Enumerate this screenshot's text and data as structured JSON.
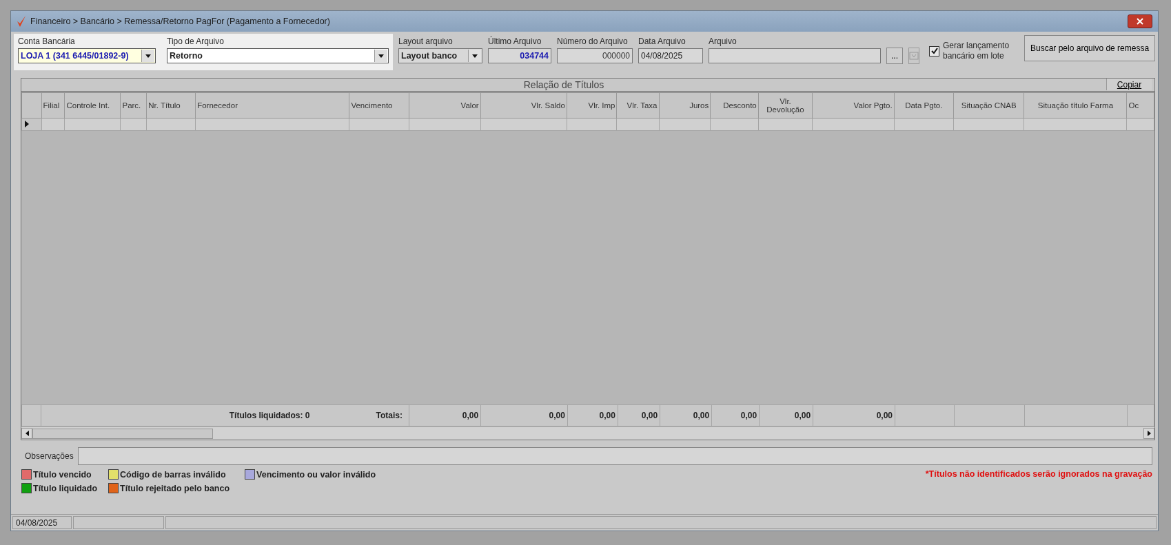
{
  "window": {
    "title": "Financeiro > Bancário > Remessa/Retorno PagFor (Pagamento  a Fornecedor)"
  },
  "filters": [
    {
      "kind": "combo",
      "label": "Conta Bancária",
      "value": "LOJA 1 (341 6445/01892-9)",
      "highlighted": true
    },
    {
      "kind": "combo",
      "label": "Tipo de Arquivo",
      "value": "Retorno",
      "highlighted": true
    },
    {
      "kind": "combo",
      "label": "Layout arquivo",
      "value": "Layout banco",
      "highlighted": false
    },
    {
      "kind": "number",
      "label": "Último Arquivo",
      "value": "034744",
      "highlighted": false
    },
    {
      "kind": "number",
      "label": "Número do Arquivo",
      "value": "000000",
      "highlighted": false
    },
    {
      "kind": "text",
      "label": "Data Arquivo",
      "value": "04/08/2025",
      "highlighted": false
    },
    {
      "kind": "file",
      "label": "Arquivo",
      "highlighted": false
    }
  ],
  "browse_button": "...",
  "batch_checkbox": {
    "label": "Gerar lançamento bancário em lote",
    "checked": true
  },
  "search_button": "Buscar pelo arquivo de remessa",
  "grid": {
    "title": "Relação de Títulos",
    "copy_button": "Copiar",
    "columns": [
      {
        "label": "Filial"
      },
      {
        "label": "Controle Int."
      },
      {
        "label": "Parc."
      },
      {
        "label": "Nr. Título"
      },
      {
        "label": "Fornecedor"
      },
      {
        "label": "Vencimento"
      },
      {
        "label": "Valor"
      },
      {
        "label": "Vlr. Saldo"
      },
      {
        "label": "Vlr. Imp"
      },
      {
        "label": "Vlr. Taxa"
      },
      {
        "label": "Juros"
      },
      {
        "label": "Desconto"
      },
      {
        "label": "Vlr. Devolução"
      },
      {
        "label": "Valor Pgto."
      },
      {
        "label": "Data Pgto."
      },
      {
        "label": "Situação CNAB"
      },
      {
        "label": "Situação título Farma"
      },
      {
        "label": "Oc"
      }
    ],
    "totals": {
      "count_label": "Títulos liquidados: 0",
      "label": "Totais:",
      "values": [
        "0,00",
        "0,00",
        "0,00",
        "0,00",
        "0,00",
        "0,00",
        "0,00",
        "0,00"
      ]
    }
  },
  "notes": {
    "label": "Observações"
  },
  "legend": [
    {
      "label": "Título vencido",
      "color": "#e06a6a"
    },
    {
      "label": "Código de barras inválido",
      "color": "#e2e06a"
    },
    {
      "label": "Vencimento ou valor inválido",
      "color": "#a8a8dc"
    },
    {
      "label": "Título liquidado",
      "color": "#10a010"
    },
    {
      "label": "Título rejeitado pelo banco",
      "color": "#e0641a"
    }
  ],
  "warning": "*Títulos não identificados serão ignorados na gravação",
  "status_bar": [
    "04/08/2025"
  ]
}
